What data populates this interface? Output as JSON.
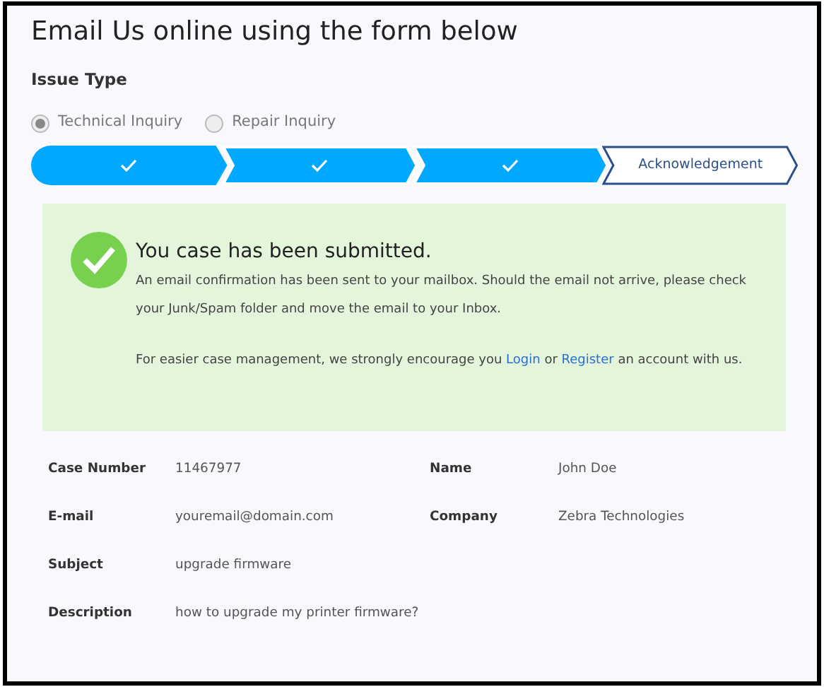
{
  "heading": "Email Us online using the form below",
  "issue_type": {
    "label": "Issue Type",
    "options": [
      {
        "label": "Technical Inquiry",
        "selected": true
      },
      {
        "label": "Repair Inquiry",
        "selected": false
      }
    ]
  },
  "steps": [
    {
      "kind": "done",
      "completed": true
    },
    {
      "kind": "done",
      "completed": true
    },
    {
      "kind": "done",
      "completed": true
    },
    {
      "kind": "label",
      "completed": false,
      "label": "Acknowledgement"
    }
  ],
  "success": {
    "title": "You case has been submitted.",
    "message": "An email confirmation has been sent to your mailbox. Should the email not arrive, please check your Junk/Spam folder and move the email to your Inbox.",
    "prompt_before": "For easier case management, we strongly encourage you",
    "login": "Login",
    "or": "or",
    "register": "Register",
    "prompt_after": "an account with us."
  },
  "details": [
    {
      "label": "Case Number",
      "value": "11467977"
    },
    {
      "label": "Name",
      "value": "John Doe"
    },
    {
      "label": "E-mail",
      "value": "youremail@domain.com"
    },
    {
      "label": "Company",
      "value": "Zebra Technologies"
    },
    {
      "label": "Subject",
      "value": "upgrade firmware"
    },
    {
      "label": "Description",
      "value": "how to upgrade my printer firmware?"
    }
  ]
}
